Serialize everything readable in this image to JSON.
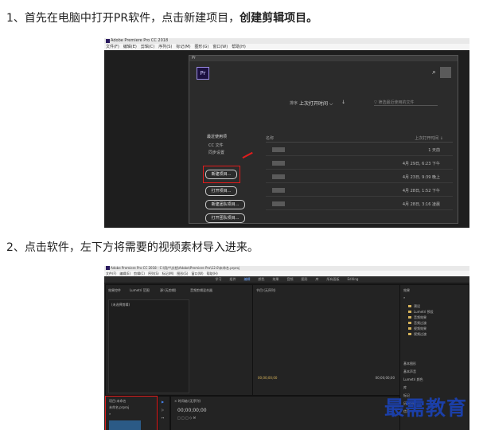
{
  "step1": {
    "text": "1、首先在电脑中打开PR软件，点击新建项目，",
    "bold": "创建剪辑项目。"
  },
  "step2": {
    "text": "2、点击软件，左下方将需要的视频素材导入进来。"
  },
  "screenshot1": {
    "app_title": "Adobe Premiere Pro CC 2018",
    "menu": [
      "文件(F)",
      "编辑(E)",
      "剪辑(C)",
      "序列(S)",
      "标记(M)",
      "图形(G)",
      "窗口(W)",
      "帮助(H)"
    ],
    "dialog_title": "Pr",
    "logo": "Pr",
    "sort_label": "排序",
    "sort_value": "上次打开时间",
    "filter_placeholder": "筛选最近使用的文件",
    "sidebar": {
      "heading": "最近使用项",
      "items": [
        "CC 文件",
        "同步设置"
      ]
    },
    "buttons": [
      "新建项目...",
      "打开项目...",
      "新建团队项目...",
      "打开团队项目..."
    ],
    "column_header": "上次打开时间",
    "rows": [
      {
        "date": "1 天前"
      },
      {
        "date": "4月 29日, 6:23 下午"
      },
      {
        "date": "4月 23日, 9:39 晚上"
      },
      {
        "date": "4月 28日, 1:52 下午"
      },
      {
        "date": "4月 28日, 3:16 凌晨"
      }
    ]
  },
  "screenshot2": {
    "app_title": "Adobe Premiere Pro CC 2018 - C:\\用户\\文档\\Adobe\\Premiere Pro\\12.0\\未命名.prproj",
    "menu": [
      "文件(F)",
      "编辑(E)",
      "剪辑(C)",
      "序列(S)",
      "标记(M)",
      "图形(G)",
      "窗口(W)",
      "帮助(H)"
    ],
    "workspaces": [
      "学习",
      "组件",
      "编辑",
      "颜色",
      "效果",
      "音频",
      "图形",
      "库",
      "所有面板",
      "Editing"
    ],
    "panels": {
      "source_tabs": [
        "效果控件",
        "Lumetri 范围",
        "源:(无剪辑)",
        "音频剪辑混合器"
      ],
      "source_sub": "(未选择剪辑)",
      "program": "节目:(无序列)",
      "program_tc_left": "00;00;00;00",
      "program_tc_right": "00;00;00;00",
      "effects_title": "效果",
      "effects_items": [
        "预设",
        "Lumetri 预设",
        "音频效果",
        "音频过渡",
        "视频效果",
        "视频过渡"
      ],
      "right_extra": [
        "基本图形",
        "基本声音",
        "Lumetri 颜色",
        "库",
        "标记",
        "历史记录",
        "信息"
      ],
      "project_title": "项目:未命名",
      "project_sub": "未命名.prproj",
      "timeline": "× 时间轴:(无序列)",
      "timeline_tc": "00;00;00;00"
    }
  },
  "watermark": "最需教育",
  "colors": {
    "highlight_red": "#e01c1c",
    "watermark_blue": "#1b3fa8",
    "pr_purple": "#9a8ce6"
  },
  "icons": [
    "search-icon",
    "user-icon",
    "filter-icon",
    "sort-arrow-icon",
    "red-arrow-icon"
  ]
}
